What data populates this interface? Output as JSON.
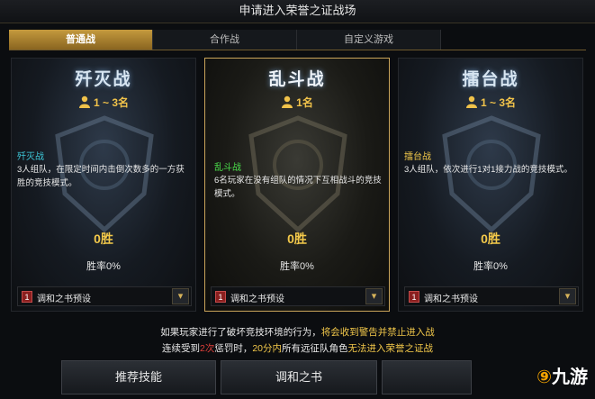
{
  "window": {
    "title": "申请进入荣誉之证战场"
  },
  "tabs": [
    {
      "label": "普通战",
      "active": true
    },
    {
      "label": "合作战",
      "active": false
    },
    {
      "label": "自定义游戏",
      "active": false
    }
  ],
  "cards": [
    {
      "title": "歼灭战",
      "players": "1 ~ 3名",
      "mode_name": "歼灭战",
      "mode_color": "#3ec7d8",
      "desc": "3人组队，在限定时间内击倒次数多的一方获胜的竞技模式。",
      "wins": "0胜",
      "rate": "胜率0%",
      "preset_num": "1",
      "preset_label": "调和之书预设",
      "selected": false
    },
    {
      "title": "乱斗战",
      "players": "1名",
      "mode_name": "乱斗战",
      "mode_color": "#4be04b",
      "desc": "6名玩家在没有组队的情况下互相战斗的竞技模式。",
      "wins": "0胜",
      "rate": "胜率0%",
      "preset_num": "1",
      "preset_label": "调和之书预设",
      "selected": true
    },
    {
      "title": "擂台战",
      "players": "1 ~ 3名",
      "mode_name": "擂台战",
      "mode_color": "#f2c84a",
      "desc": "3人组队，依次进行1对1接力战的竞技模式。",
      "wins": "0胜",
      "rate": "胜率0%",
      "preset_num": "1",
      "preset_label": "调和之书预设",
      "selected": false
    }
  ],
  "notice": {
    "l1a": "如果玩家进行了破坏竞技环境的行为，",
    "l1b": "将会收到警告并禁止进入战",
    "l2a": "连续受到",
    "l2b": "2次",
    "l2c": "惩罚时，",
    "l2d": "20分内",
    "l2e": "所有远征队角色",
    "l2f": "无法进入荣誉之证战"
  },
  "buttons": {
    "skills": "推荐技能",
    "harmony": "调和之书"
  },
  "watermark": "九游",
  "icons": {
    "players": "person-icon",
    "dropdown": "chevron-down-icon",
    "watermark": "9game-logo"
  }
}
